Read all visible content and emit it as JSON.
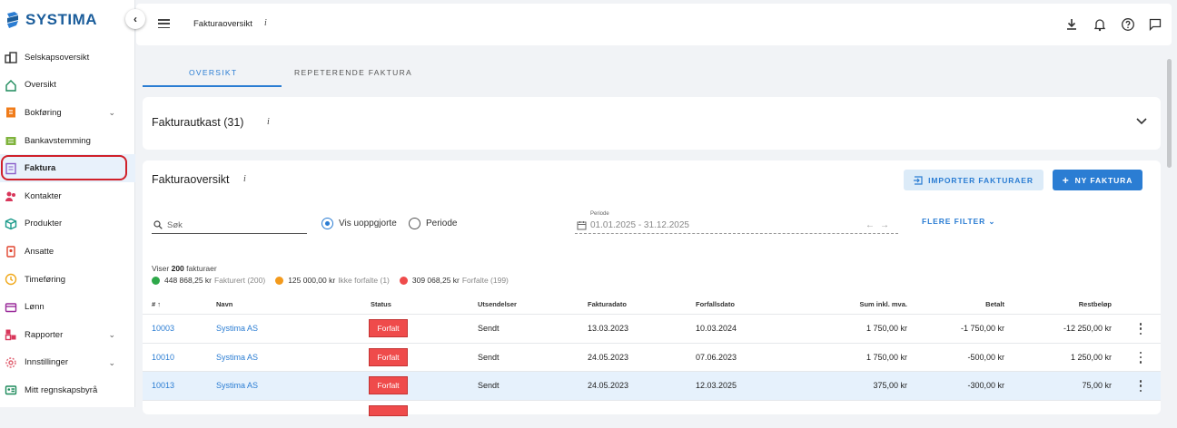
{
  "brand": {
    "name": "SYSTIMA",
    "color": "#1b5d9b"
  },
  "sidebar": {
    "items": [
      {
        "label": "Selskapsoversikt",
        "icon": "buildings-icon",
        "color": "#333333",
        "chevron": false
      },
      {
        "label": "Oversikt",
        "icon": "home-icon",
        "color": "#1d8a5b",
        "chevron": false
      },
      {
        "label": "Bokføring",
        "icon": "ledger-icon",
        "color": "#f07c1a",
        "chevron": true
      },
      {
        "label": "Bankavstemming",
        "icon": "bank-reconcile-icon",
        "color": "#7fb33c",
        "chevron": false
      },
      {
        "label": "Faktura",
        "icon": "invoice-icon",
        "color": "#8a5cc9",
        "chevron": false,
        "active": true
      },
      {
        "label": "Kontakter",
        "icon": "contacts-icon",
        "color": "#d8365a",
        "chevron": false
      },
      {
        "label": "Produkter",
        "icon": "box-icon",
        "color": "#1a9a8a",
        "chevron": false
      },
      {
        "label": "Ansatte",
        "icon": "employee-badge-icon",
        "color": "#e0442e",
        "chevron": false
      },
      {
        "label": "Timeføring",
        "icon": "clock-icon",
        "color": "#f0a81a",
        "chevron": false
      },
      {
        "label": "Lønn",
        "icon": "wallet-icon",
        "color": "#9a2a9a",
        "chevron": false
      },
      {
        "label": "Rapporter",
        "icon": "reports-icon",
        "color": "#d8365a",
        "chevron": true
      },
      {
        "label": "Innstillinger",
        "icon": "gear-icon",
        "color": "#e06070",
        "chevron": true
      },
      {
        "label": "Mitt regnskapsbyrå",
        "icon": "id-card-icon",
        "color": "#1d8a5b",
        "chevron": false
      }
    ]
  },
  "topbar": {
    "breadcrumb": "Fakturaoversikt",
    "info": "i"
  },
  "tabs": [
    {
      "label": "OVERSIKT",
      "active": true
    },
    {
      "label": "REPETERENDE FAKTURA",
      "active": false
    }
  ],
  "draft": {
    "title": "Fakturautkast (31)",
    "info": "i"
  },
  "overview": {
    "title": "Fakturaoversikt",
    "info": "i",
    "import_button": "IMPORTER FAKTURAER",
    "new_button": "NY FAKTURA",
    "search_placeholder": "Søk",
    "radio_unsettled": "Vis uoppgjorte",
    "radio_period": "Periode",
    "period_label": "Periode",
    "period_value": "01.01.2025 - 31.12.2025",
    "more_filters": "FLERE FILTER",
    "showing_prefix": "Viser",
    "showing_count": "200",
    "showing_suffix": "fakturaer",
    "summary": [
      {
        "amount": "448 868,25 kr",
        "label": "Fakturert (200)",
        "color": "#2ea84a"
      },
      {
        "amount": "125 000,00 kr",
        "label": "Ikke forfalte (1)",
        "color": "#f39a1c"
      },
      {
        "amount": "309 068,25 kr",
        "label": "Forfalte (199)",
        "color": "#ef4b4b"
      }
    ]
  },
  "table": {
    "headers": {
      "num": "#",
      "name": "Navn",
      "status": "Status",
      "sent": "Utsendelser",
      "invoice_date": "Fakturadato",
      "due_date": "Forfallsdato",
      "sum": "Sum inkl. mva.",
      "paid": "Betalt",
      "remaining": "Restbeløp"
    },
    "rows": [
      {
        "num": "10003",
        "name": "Systima AS",
        "status": "Forfalt",
        "sent": "Sendt",
        "invoice_date": "13.03.2023",
        "due_date": "10.03.2024",
        "sum": "1 750,00 kr",
        "paid": "-1 750,00 kr",
        "remaining": "-12 250,00 kr"
      },
      {
        "num": "10010",
        "name": "Systima AS",
        "status": "Forfalt",
        "sent": "Sendt",
        "invoice_date": "24.05.2023",
        "due_date": "07.06.2023",
        "sum": "1 750,00 kr",
        "paid": "-500,00 kr",
        "remaining": "1 250,00 kr"
      },
      {
        "num": "10013",
        "name": "Systima AS",
        "status": "Forfalt",
        "sent": "Sendt",
        "invoice_date": "24.05.2023",
        "due_date": "12.03.2025",
        "sum": "375,00 kr",
        "paid": "-300,00 kr",
        "remaining": "75,00 kr",
        "selected": true
      },
      {
        "num": "",
        "name": "",
        "status": "",
        "sent": "",
        "invoice_date": "",
        "due_date": "",
        "sum": "",
        "paid": "",
        "remaining": ""
      }
    ]
  }
}
